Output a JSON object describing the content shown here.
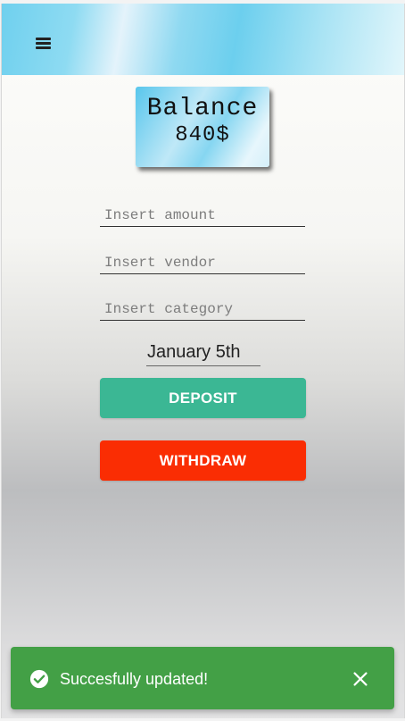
{
  "header": {
    "menu_icon": "hamburger-menu-icon"
  },
  "balance": {
    "title": "Balance",
    "amount": "840$"
  },
  "form": {
    "amount_placeholder": "Insert amount",
    "amount_value": "",
    "vendor_placeholder": "Insert vendor",
    "vendor_value": "",
    "category_placeholder": "Insert category",
    "category_value": "",
    "date_value": "January 5th"
  },
  "actions": {
    "deposit_label": "DEPOSIT",
    "withdraw_label": "WITHDRAW"
  },
  "toast": {
    "icon": "check-circle-icon",
    "message": "Succesfully updated!",
    "close_icon": "close-icon"
  },
  "colors": {
    "header_accent": "#6fd0ee",
    "deposit": "#3bb794",
    "withdraw": "#fa2d03",
    "toast_success": "#43a046"
  }
}
